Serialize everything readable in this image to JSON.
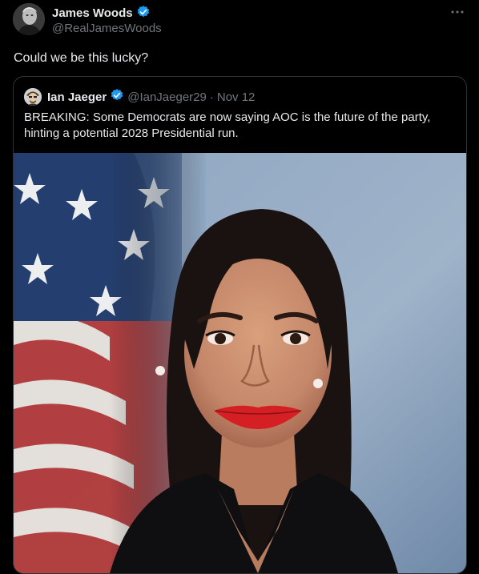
{
  "post": {
    "author": {
      "name": "James Woods",
      "handle": "@RealJamesWoods",
      "verified": true,
      "avatar_icon": "grayscale-portrait"
    },
    "more_icon": "more-horizontal-icon",
    "text": "Could we be this lucky?"
  },
  "quote": {
    "author": {
      "name": "Ian Jaeger",
      "handle": "@IanJaeger29",
      "verified": true,
      "avatar_icon": "cartoon-portrait"
    },
    "separator": "·",
    "date": "Nov 12",
    "text": "BREAKING: Some Democrats are now saying AOC is the future of the party, hinting a potential 2028 Presidential run.",
    "media": {
      "type": "photo",
      "description_icon": "portrait-photo-with-flag"
    }
  },
  "colors": {
    "background": "#000000",
    "text_primary": "#e7e9ea",
    "text_secondary": "#71767b",
    "verified_blue": "#1d9bf0",
    "border": "#2f3336"
  }
}
